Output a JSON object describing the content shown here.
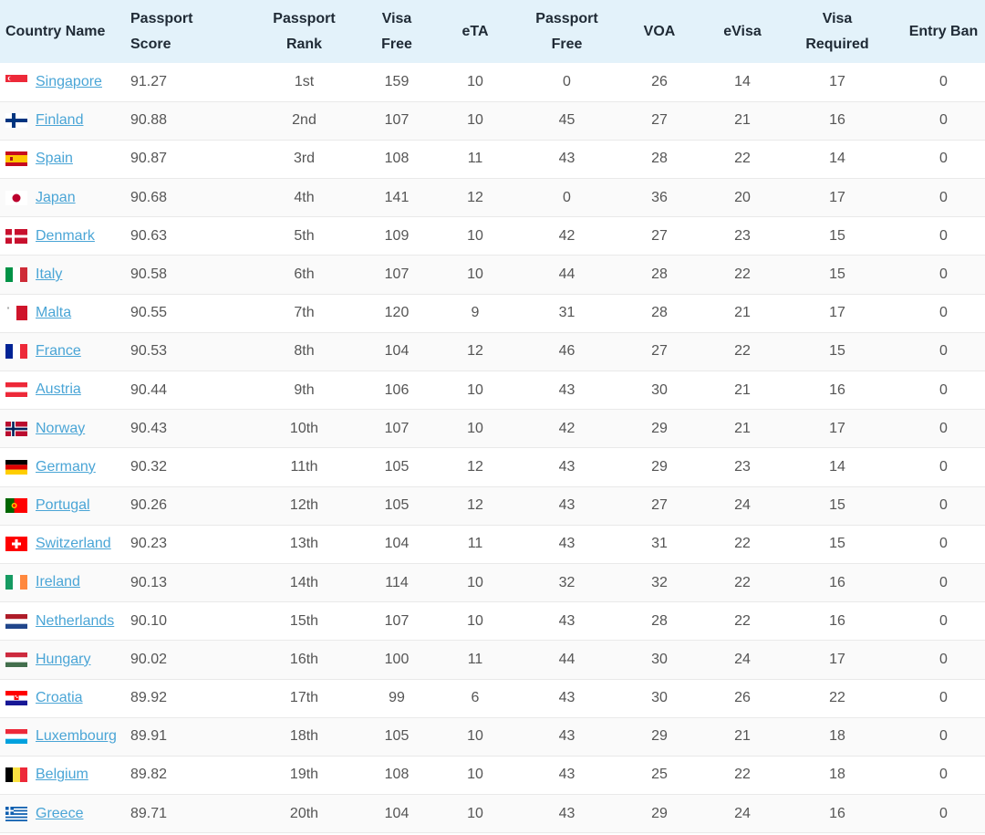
{
  "columns": [
    "Country Name",
    "Passport Score",
    "Passport\nRank",
    "Visa Free",
    "eTA",
    "Passport\nFree",
    "VOA",
    "eVisa",
    "Visa\nRequired",
    "Entry Ban"
  ],
  "rows": [
    {
      "country": "Singapore",
      "flag": "singapore-flag",
      "score": "91.27",
      "rank": "1st",
      "visa_free": "159",
      "eta": "10",
      "passport_free": "0",
      "voa": "26",
      "evisa": "14",
      "visa_required": "17",
      "entry_ban": "0"
    },
    {
      "country": "Finland",
      "flag": "finland-flag",
      "score": "90.88",
      "rank": "2nd",
      "visa_free": "107",
      "eta": "10",
      "passport_free": "45",
      "voa": "27",
      "evisa": "21",
      "visa_required": "16",
      "entry_ban": "0"
    },
    {
      "country": "Spain",
      "flag": "spain-flag",
      "score": "90.87",
      "rank": "3rd",
      "visa_free": "108",
      "eta": "11",
      "passport_free": "43",
      "voa": "28",
      "evisa": "22",
      "visa_required": "14",
      "entry_ban": "0"
    },
    {
      "country": "Japan",
      "flag": "japan-flag",
      "score": "90.68",
      "rank": "4th",
      "visa_free": "141",
      "eta": "12",
      "passport_free": "0",
      "voa": "36",
      "evisa": "20",
      "visa_required": "17",
      "entry_ban": "0"
    },
    {
      "country": "Denmark",
      "flag": "denmark-flag",
      "score": "90.63",
      "rank": "5th",
      "visa_free": "109",
      "eta": "10",
      "passport_free": "42",
      "voa": "27",
      "evisa": "23",
      "visa_required": "15",
      "entry_ban": "0"
    },
    {
      "country": "Italy",
      "flag": "italy-flag",
      "score": "90.58",
      "rank": "6th",
      "visa_free": "107",
      "eta": "10",
      "passport_free": "44",
      "voa": "28",
      "evisa": "22",
      "visa_required": "15",
      "entry_ban": "0"
    },
    {
      "country": "Malta",
      "flag": "malta-flag",
      "score": "90.55",
      "rank": "7th",
      "visa_free": "120",
      "eta": "9",
      "passport_free": "31",
      "voa": "28",
      "evisa": "21",
      "visa_required": "17",
      "entry_ban": "0"
    },
    {
      "country": "France",
      "flag": "france-flag",
      "score": "90.53",
      "rank": "8th",
      "visa_free": "104",
      "eta": "12",
      "passport_free": "46",
      "voa": "27",
      "evisa": "22",
      "visa_required": "15",
      "entry_ban": "0"
    },
    {
      "country": "Austria",
      "flag": "austria-flag",
      "score": "90.44",
      "rank": "9th",
      "visa_free": "106",
      "eta": "10",
      "passport_free": "43",
      "voa": "30",
      "evisa": "21",
      "visa_required": "16",
      "entry_ban": "0"
    },
    {
      "country": "Norway",
      "flag": "norway-flag",
      "score": "90.43",
      "rank": "10th",
      "visa_free": "107",
      "eta": "10",
      "passport_free": "42",
      "voa": "29",
      "evisa": "21",
      "visa_required": "17",
      "entry_ban": "0"
    },
    {
      "country": "Germany",
      "flag": "germany-flag",
      "score": "90.32",
      "rank": "11th",
      "visa_free": "105",
      "eta": "12",
      "passport_free": "43",
      "voa": "29",
      "evisa": "23",
      "visa_required": "14",
      "entry_ban": "0"
    },
    {
      "country": "Portugal",
      "flag": "portugal-flag",
      "score": "90.26",
      "rank": "12th",
      "visa_free": "105",
      "eta": "12",
      "passport_free": "43",
      "voa": "27",
      "evisa": "24",
      "visa_required": "15",
      "entry_ban": "0"
    },
    {
      "country": "Switzerland",
      "flag": "switzerland-flag",
      "score": "90.23",
      "rank": "13th",
      "visa_free": "104",
      "eta": "11",
      "passport_free": "43",
      "voa": "31",
      "evisa": "22",
      "visa_required": "15",
      "entry_ban": "0"
    },
    {
      "country": "Ireland",
      "flag": "ireland-flag",
      "score": "90.13",
      "rank": "14th",
      "visa_free": "114",
      "eta": "10",
      "passport_free": "32",
      "voa": "32",
      "evisa": "22",
      "visa_required": "16",
      "entry_ban": "0"
    },
    {
      "country": "Netherlands",
      "flag": "netherlands-flag",
      "score": "90.10",
      "rank": "15th",
      "visa_free": "107",
      "eta": "10",
      "passport_free": "43",
      "voa": "28",
      "evisa": "22",
      "visa_required": "16",
      "entry_ban": "0"
    },
    {
      "country": "Hungary",
      "flag": "hungary-flag",
      "score": "90.02",
      "rank": "16th",
      "visa_free": "100",
      "eta": "11",
      "passport_free": "44",
      "voa": "30",
      "evisa": "24",
      "visa_required": "17",
      "entry_ban": "0"
    },
    {
      "country": "Croatia",
      "flag": "croatia-flag",
      "score": "89.92",
      "rank": "17th",
      "visa_free": "99",
      "eta": "6",
      "passport_free": "43",
      "voa": "30",
      "evisa": "26",
      "visa_required": "22",
      "entry_ban": "0"
    },
    {
      "country": "Luxembourg",
      "flag": "luxembourg-flag",
      "score": "89.91",
      "rank": "18th",
      "visa_free": "105",
      "eta": "10",
      "passport_free": "43",
      "voa": "29",
      "evisa": "21",
      "visa_required": "18",
      "entry_ban": "0"
    },
    {
      "country": "Belgium",
      "flag": "belgium-flag",
      "score": "89.82",
      "rank": "19th",
      "visa_free": "108",
      "eta": "10",
      "passport_free": "43",
      "voa": "25",
      "evisa": "22",
      "visa_required": "18",
      "entry_ban": "0"
    },
    {
      "country": "Greece",
      "flag": "greece-flag",
      "score": "89.71",
      "rank": "20th",
      "visa_free": "104",
      "eta": "10",
      "passport_free": "43",
      "voa": "29",
      "evisa": "24",
      "visa_required": "16",
      "entry_ban": "0"
    }
  ],
  "colors": {
    "header_bg": "#e3f2fa",
    "link": "#4aa5d6",
    "row_alt": "#fafafa",
    "border": "#e9e9e9"
  }
}
